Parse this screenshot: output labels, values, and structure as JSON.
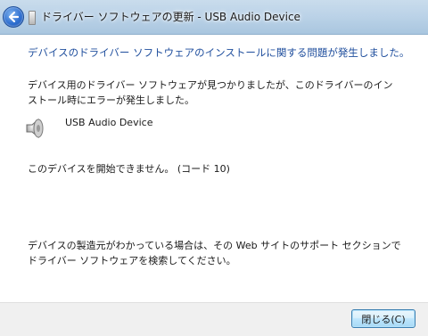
{
  "window": {
    "title": "ドライバー ソフトウェアの更新 - USB Audio Device"
  },
  "content": {
    "heading": "デバイスのドライバー ソフトウェアのインストールに関する問題が発生しました。",
    "found_message": "デバイス用のドライバー ソフトウェアが見つかりましたが、このドライバーのインストール時にエラーが発生しました。",
    "device_name": "USB Audio Device",
    "device_icon": "speaker-icon",
    "error_message": "このデバイスを開始できません。 (コード 10)",
    "manufacturer_message": "デバイスの製造元がわかっている場合は、その Web サイトのサポート セクションでドライバー ソフトウェアを検索してください。"
  },
  "footer": {
    "close_label": "閉じる(C)"
  },
  "colors": {
    "heading": "#1f4e9d",
    "titlebar": "#bcd3e8",
    "footer": "#f0f0f0"
  }
}
